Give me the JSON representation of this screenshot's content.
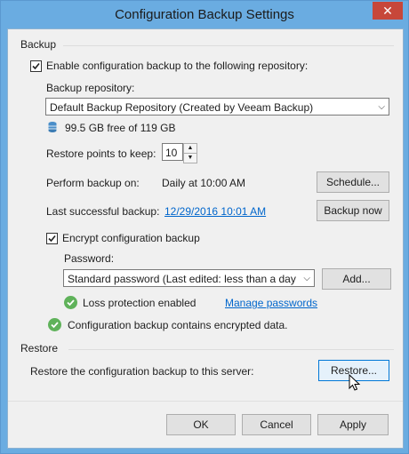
{
  "window": {
    "title": "Configuration Backup Settings",
    "close_glyph": "✕"
  },
  "backup": {
    "section_label": "Backup",
    "enable_label": "Enable configuration backup to the following repository:",
    "enable_checked": true,
    "repository_label": "Backup repository:",
    "repository_value": "Default Backup Repository (Created by Veeam Backup)",
    "free_space": "99.5 GB free of 119 GB",
    "restore_points_label": "Restore points to keep:",
    "restore_points_value": "10",
    "perform_label": "Perform backup on:",
    "perform_value": "Daily at 10:00 AM",
    "schedule_button": "Schedule...",
    "last_success_label": "Last successful backup:",
    "last_success_value": "12/29/2016 10:01 AM",
    "backup_now_button": "Backup now",
    "encrypt_label": "Encrypt configuration backup",
    "encrypt_checked": true,
    "password_label": "Password:",
    "password_value": "Standard password (Last edited: less than a day ago)",
    "add_button": "Add...",
    "loss_protection": "Loss protection enabled",
    "manage_passwords_link": "Manage passwords",
    "encrypted_status": "Configuration backup contains encrypted data."
  },
  "restore": {
    "section_label": "Restore",
    "restore_description": "Restore the configuration backup to this server:",
    "restore_button": "Restore..."
  },
  "footer": {
    "ok": "OK",
    "cancel": "Cancel",
    "apply": "Apply"
  },
  "colors": {
    "titlebar": "#6aace1",
    "close": "#c7473a",
    "link": "#0066cc",
    "success": "#5fb25a"
  }
}
